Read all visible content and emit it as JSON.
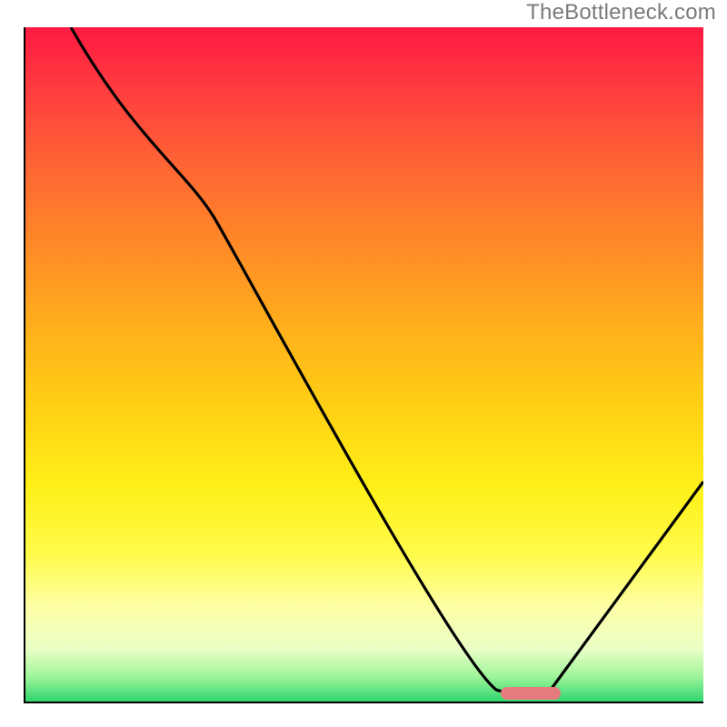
{
  "watermark": "TheBottleneck.com",
  "chart_data": {
    "type": "line",
    "title": "",
    "xlabel": "",
    "ylabel": "",
    "xlim": [
      0,
      100
    ],
    "ylim": [
      0,
      100
    ],
    "grid": false,
    "x": [
      7,
      28,
      71,
      78,
      100
    ],
    "values": [
      100,
      77,
      2,
      2,
      34
    ],
    "marker": {
      "x_start": 71,
      "x_end": 79,
      "y": 1
    },
    "background": "heat-gradient-red-to-green"
  },
  "colors": {
    "curve": "#000000",
    "axis": "#000000",
    "marker": "#e87b80",
    "watermark": "#7a7a7a"
  }
}
